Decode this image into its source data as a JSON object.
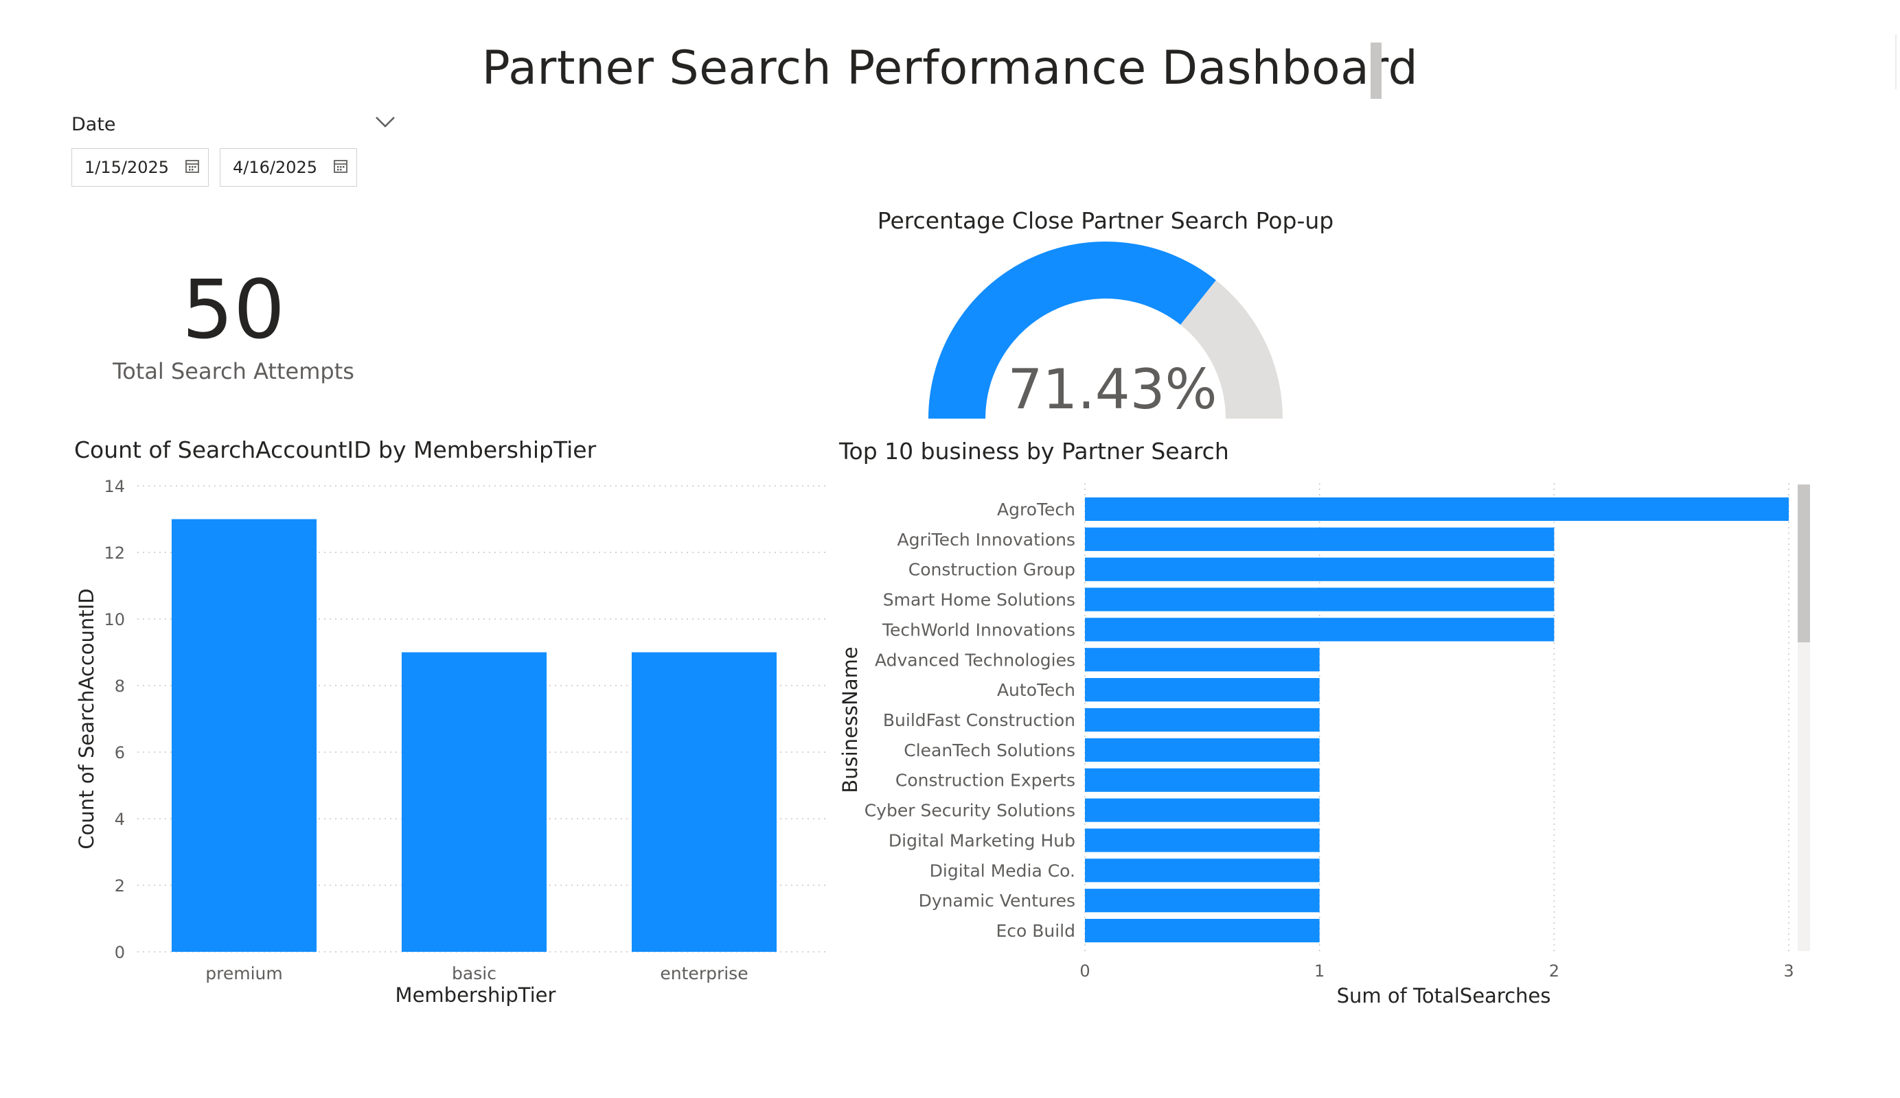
{
  "header": {
    "title": "Partner Search Performance Dashboard"
  },
  "date_slicer": {
    "label": "Date",
    "start": "1/15/2025",
    "end": "4/16/2025",
    "chevron_icon": "chevron-down-icon",
    "calendar_icon": "calendar-icon"
  },
  "kpi_card": {
    "value": "50",
    "label": "Total Search Attempts"
  },
  "gauge": {
    "title": "Percentage Close Partner Search Pop-up",
    "value_label": "71.43%",
    "value": 71.43,
    "min": 0,
    "max": 100,
    "fill_color": "#118DFF",
    "track_color": "#E1DFDD"
  },
  "chart_data": [
    {
      "type": "bar",
      "title": "Count of SearchAccountID by MembershipTier",
      "xlabel": "MembershipTier",
      "ylabel": "Count of SearchAccountID",
      "categories": [
        "premium",
        "basic",
        "enterprise"
      ],
      "values": [
        13,
        9,
        9
      ],
      "ylim": [
        0,
        14
      ],
      "yticks": [
        0,
        2,
        4,
        6,
        8,
        10,
        12,
        14
      ],
      "grid": true,
      "color": "#118DFF"
    },
    {
      "type": "bar",
      "orientation": "horizontal",
      "title": "Top 10 business by Partner Search",
      "xlabel": "Sum of TotalSearches",
      "ylabel": "BusinessName",
      "categories": [
        "AgroTech",
        "AgriTech Innovations",
        "Construction Group",
        "Smart Home Solutions",
        "TechWorld Innovations",
        "Advanced Technologies",
        "AutoTech",
        "BuildFast Construction",
        "CleanTech Solutions",
        "Construction Experts",
        "Cyber Security Solutions",
        "Digital Marketing Hub",
        "Digital Media Co.",
        "Dynamic Ventures",
        "Eco Build"
      ],
      "values": [
        3,
        2,
        2,
        2,
        2,
        1,
        1,
        1,
        1,
        1,
        1,
        1,
        1,
        1,
        1
      ],
      "xlim": [
        0,
        3
      ],
      "xticks": [
        0,
        1,
        2,
        3
      ],
      "grid": true,
      "color": "#118DFF"
    }
  ]
}
